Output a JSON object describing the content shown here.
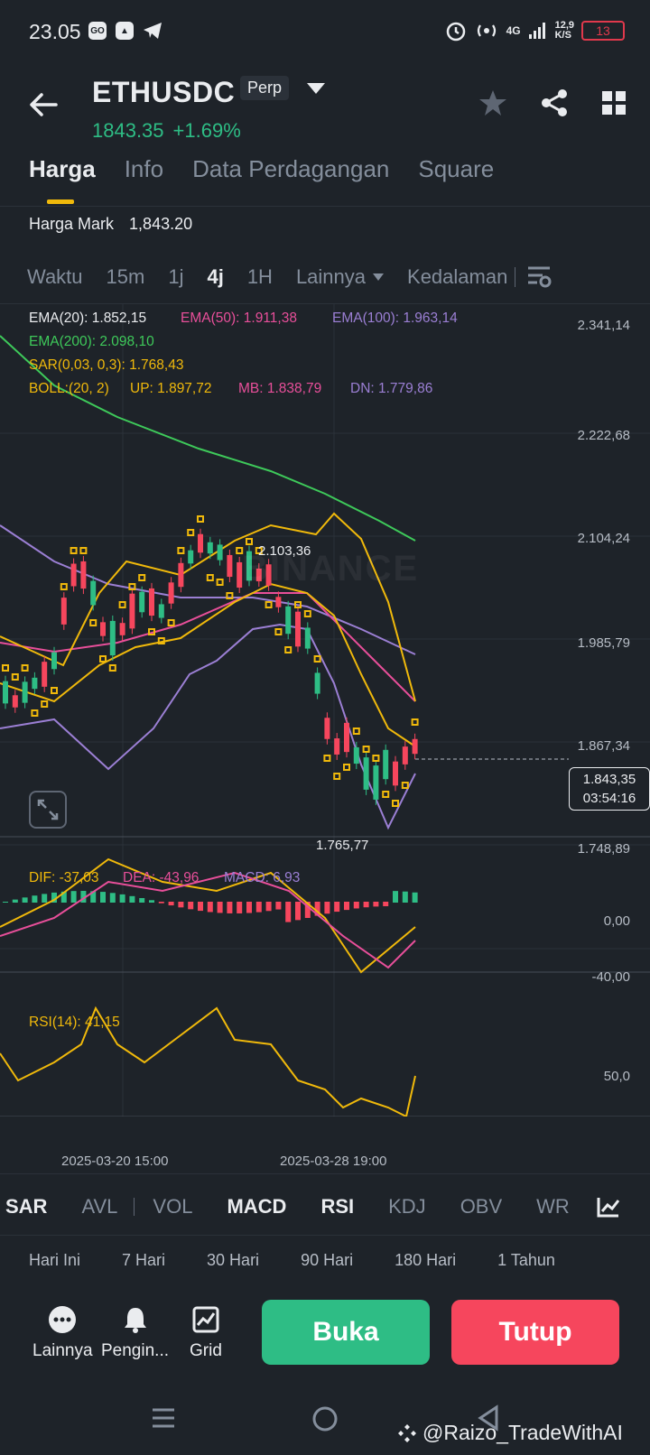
{
  "status": {
    "time": "23.05",
    "network": "4G",
    "speed_top": "12,9",
    "speed_bottom": "K/S",
    "battery": "13"
  },
  "header": {
    "pair": "ETHUSDC",
    "type": "Perp",
    "price": "1843.35",
    "change": "+1.69%"
  },
  "tabs": [
    "Harga",
    "Info",
    "Data Perdagangan",
    "Square"
  ],
  "mark": {
    "label": "Harga Mark",
    "value": "1,843.20"
  },
  "timebar": [
    "Waktu",
    "15m",
    "1j",
    "4j",
    "1H",
    "Lainnya",
    "Kedalaman"
  ],
  "indicators": {
    "ema20": "EMA(20): 1.852,15",
    "ema50": "EMA(50): 1.911,38",
    "ema100": "EMA(100): 1.963,14",
    "ema200": "EMA(200): 2.098,10",
    "sar": "SAR(0,03, 0,3): 1.768,43",
    "boll": "BOLL:(20, 2)",
    "boll_up": "UP: 1.897,72",
    "boll_mb": "MB: 1.838,79",
    "boll_dn": "DN: 1.779,86"
  },
  "price_axis": [
    "2.341,14",
    "2.222,68",
    "2.104,24",
    "1.985,79",
    "1.867,34",
    "1.748,89"
  ],
  "current_price_tag": {
    "price": "1.843,35",
    "countdown": "03:54:16"
  },
  "annotations": {
    "high": "2.103,36",
    "low": "1.765,77",
    "watermark": "BINANCE"
  },
  "macd": {
    "dif": "DIF: -37,03",
    "dea": "DEA: -43,96",
    "macd": "MACD: 6,93",
    "axis": [
      "0,00",
      "-40,00"
    ]
  },
  "rsi": {
    "label": "RSI(14): 41,15",
    "axis": [
      "50,0"
    ]
  },
  "dates": [
    "2025-03-20 15:00",
    "2025-03-28 19:00"
  ],
  "indicator_tabs": [
    "SAR",
    "AVL",
    "VOL",
    "MACD",
    "RSI",
    "KDJ",
    "OBV",
    "WR"
  ],
  "periods": [
    "Hari Ini",
    "7 Hari",
    "30 Hari",
    "90 Hari",
    "180 Hari",
    "1 Tahun"
  ],
  "bottom_actions": [
    "Lainnya",
    "Pengin...",
    "Grid"
  ],
  "buttons": {
    "open": "Buka",
    "close": "Tutup"
  },
  "watermark": "@Raizo_TradeWithAI",
  "colors": {
    "up": "#2ebd85",
    "down": "#f6465d",
    "ema20": "#f0b90b",
    "ema50": "#e84f9a",
    "ema100": "#9b7fd4",
    "ema200": "#3ec95a",
    "sar": "#f0b90b"
  },
  "chart_data": {
    "type": "candlestick",
    "series": [
      {
        "name": "EMA(20)",
        "values": [
          1.852
        ]
      },
      {
        "name": "EMA(50)",
        "values": [
          1.911
        ]
      },
      {
        "name": "EMA(100)",
        "values": [
          1.963
        ]
      },
      {
        "name": "EMA(200)",
        "values": [
          2.098
        ]
      }
    ],
    "ylim": [
      1.7489,
      2.3411
    ],
    "x_ticks": [
      "2025-03-20 15:00",
      "2025-03-28 19:00"
    ]
  }
}
